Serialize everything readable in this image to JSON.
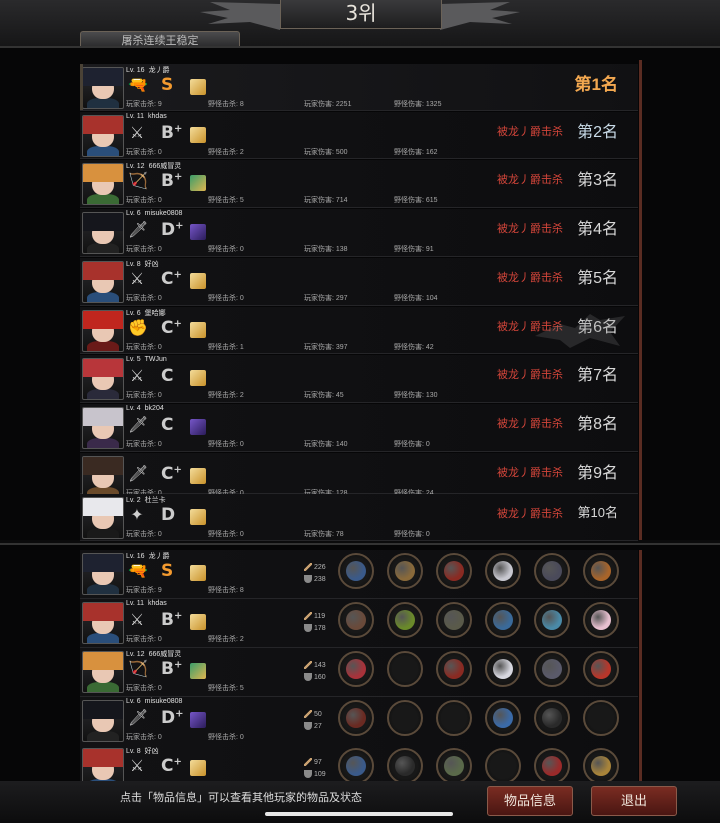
{
  "header": {
    "title": "3위",
    "tab_label": "屠杀连续王稳定"
  },
  "ranking": [
    {
      "level": "Lv. 16",
      "name": "龙丿爵",
      "grade": "S",
      "grade_sup": "",
      "player_kills": "玩家击杀: 9",
      "monster_kills": "野怪击杀: 8",
      "player_damage": "玩家伤害: 2251",
      "monster_damage": "野怪伤害: 1325",
      "killed_by": "",
      "rank": "第1名",
      "hair": "#1e2230",
      "cloth": "#203040",
      "pet": "gold",
      "weapon": "🔫"
    },
    {
      "level": "Lv. 11",
      "name": "khdas",
      "grade": "B",
      "grade_sup": "+",
      "player_kills": "玩家击杀: 0",
      "monster_kills": "野怪击杀: 2",
      "player_damage": "玩家伤害: 500",
      "monster_damage": "野怪伤害: 162",
      "killed_by": "被龙丿爵击杀",
      "rank": "第2名",
      "hair": "#a8322c",
      "cloth": "#2a4e7a",
      "pet": "gold",
      "weapon": "⚔"
    },
    {
      "level": "Lv. 12",
      "name": "666威冒灵",
      "grade": "B",
      "grade_sup": "+",
      "player_kills": "玩家击杀: 0",
      "monster_kills": "野怪击杀: 5",
      "player_damage": "玩家伤害: 714",
      "monster_damage": "野怪伤害: 615",
      "killed_by": "被龙丿爵击杀",
      "rank": "第3名",
      "hair": "#d8913e",
      "cloth": "#3a6a34",
      "pet": "mixed",
      "weapon": "🏹"
    },
    {
      "level": "Lv. 6",
      "name": "misuke0808",
      "grade": "D",
      "grade_sup": "+",
      "player_kills": "玩家击杀: 0",
      "monster_kills": "野怪击杀: 0",
      "player_damage": "玩家伤害: 138",
      "monster_damage": "野怪伤害: 91",
      "killed_by": "被龙丿爵击杀",
      "rank": "第4名",
      "hair": "#15161c",
      "cloth": "#222",
      "pet": "purple",
      "weapon": "🗡"
    },
    {
      "level": "Lv. 8",
      "name": "好凶",
      "grade": "C",
      "grade_sup": "+",
      "player_kills": "玩家击杀: 0",
      "monster_kills": "野怪击杀: 0",
      "player_damage": "玩家伤害: 297",
      "monster_damage": "野怪伤害: 104",
      "killed_by": "被龙丿爵击杀",
      "rank": "第5名",
      "hair": "#a8322c",
      "cloth": "#2a4e7a",
      "pet": "gold",
      "weapon": "⚔"
    },
    {
      "level": "Lv. 6",
      "name": "堡哈娜",
      "grade": "C",
      "grade_sup": "+",
      "player_kills": "玩家击杀: 0",
      "monster_kills": "野怪击杀: 1",
      "player_damage": "玩家伤害: 397",
      "monster_damage": "野怪伤害: 42",
      "killed_by": "被龙丿爵击杀",
      "rank": "第6名",
      "hair": "#c0261e",
      "cloth": "#6a1a18",
      "pet": "gold",
      "weapon": "✊"
    },
    {
      "level": "Lv. 5",
      "name": "TWJun",
      "grade": "C",
      "grade_sup": "",
      "player_kills": "玩家击杀: 0",
      "monster_kills": "野怪击杀: 2",
      "player_damage": "玩家伤害: 45",
      "monster_damage": "野怪伤害: 130",
      "killed_by": "被龙丿爵击杀",
      "rank": "第7名",
      "hair": "#b8363a",
      "cloth": "#2a2a3a",
      "pet": "gold",
      "weapon": "⚔"
    },
    {
      "level": "Lv. 4",
      "name": "bk204",
      "grade": "C",
      "grade_sup": "",
      "player_kills": "玩家击杀: 0",
      "monster_kills": "野怪击杀: 0",
      "player_damage": "玩家伤害: 140",
      "monster_damage": "野怪伤害: 0",
      "killed_by": "被龙丿爵击杀",
      "rank": "第8名",
      "hair": "#c8c4cc",
      "cloth": "#3a2a4a",
      "pet": "purple",
      "weapon": "🗡"
    },
    {
      "level": "",
      "name": "",
      "grade": "C",
      "grade_sup": "+",
      "player_kills": "玩家击杀: 0",
      "monster_kills": "野怪击杀: 0",
      "player_damage": "玩家伤害: 128",
      "monster_damage": "野怪伤害: 24",
      "killed_by": "被龙丿爵击杀",
      "rank": "第9名",
      "hair": "#3a2a22",
      "cloth": "#6a4a2a",
      "pet": "gold",
      "weapon": "🗡"
    },
    {
      "level": "Lv. 2",
      "name": "杜兰卡",
      "grade": "D",
      "grade_sup": "",
      "player_kills": "玩家击杀: 0",
      "monster_kills": "野怪击杀: 0",
      "player_damage": "玩家伤害: 78",
      "monster_damage": "野怪伤害: 0",
      "killed_by": "被龙丿爵击杀",
      "rank": "第10名",
      "hair": "#e8e8ec",
      "cloth": "#1a1a1a",
      "pet": "gold",
      "weapon": "✦"
    }
  ],
  "gear": [
    {
      "level": "Lv. 16",
      "name": "龙丿爵",
      "grade": "S",
      "grade_sup": "",
      "player_kills": "玩家击杀: 9",
      "monster_kills": "野怪击杀: 8",
      "attack": "226",
      "defense": "238",
      "hair": "#1e2230",
      "cloth": "#203040",
      "pet": "gold",
      "weapon": "🔫",
      "items": [
        "#3a5a8a",
        "#8a6a3a",
        "#8a2a22",
        "#c8c8d0",
        "#4a4a5a",
        "#a8642a"
      ]
    },
    {
      "level": "Lv. 11",
      "name": "khdas",
      "grade": "B",
      "grade_sup": "+",
      "player_kills": "玩家击杀: 0",
      "monster_kills": "野怪击杀: 2",
      "attack": "119",
      "defense": "178",
      "hair": "#a8322c",
      "cloth": "#2a4e7a",
      "pet": "gold",
      "weapon": "⚔",
      "items": [
        "#6a4a3a",
        "#6a8a2a",
        "#5a5a4a",
        "#3a6a9a",
        "#4a8aa8",
        "#e8c0d0"
      ]
    },
    {
      "level": "Lv. 12",
      "name": "666威冒灵",
      "grade": "B",
      "grade_sup": "+",
      "player_kills": "玩家击杀: 0",
      "monster_kills": "野怪击杀: 5",
      "attack": "143",
      "defense": "160",
      "hair": "#d8913e",
      "cloth": "#3a6a34",
      "pet": "mixed",
      "weapon": "🏹",
      "items": [
        "#a8323a",
        "#0a0a0a",
        "#8a2a22",
        "#d8d8e0",
        "#5a5a6a",
        "#b8362a"
      ]
    },
    {
      "level": "Lv. 6",
      "name": "misuke0808",
      "grade": "D",
      "grade_sup": "+",
      "player_kills": "玩家击杀: 0",
      "monster_kills": "野怪击杀: 0",
      "attack": "50",
      "defense": "27",
      "hair": "#15161c",
      "cloth": "#222",
      "pet": "purple",
      "weapon": "🗡",
      "items": [
        "#6a2a22",
        "#0a0a0a",
        "#0a0a0a",
        "#3a6aa8",
        "#2a2a2a",
        "#0a0a0a"
      ]
    },
    {
      "level": "Lv. 8",
      "name": "好凶",
      "grade": "C",
      "grade_sup": "+",
      "player_kills": "",
      "monster_kills": "",
      "attack": "97",
      "defense": "109",
      "hair": "#a8322c",
      "cloth": "#2a4e7a",
      "pet": "gold",
      "weapon": "⚔",
      "items": [
        "#3a5a8a",
        "#2a2a2a",
        "#5a6a4a",
        "#0a0a0a",
        "#9a2a2a",
        "#a8843a"
      ]
    }
  ],
  "footer": {
    "hint": "点击「物品信息」可以查看其他玩家的物品及状态",
    "info_button": "物品信息",
    "exit_button": "退出"
  },
  "colors": {
    "accent": "#f39a2f",
    "killed": "#d3453a",
    "button": "#7a2c22"
  }
}
